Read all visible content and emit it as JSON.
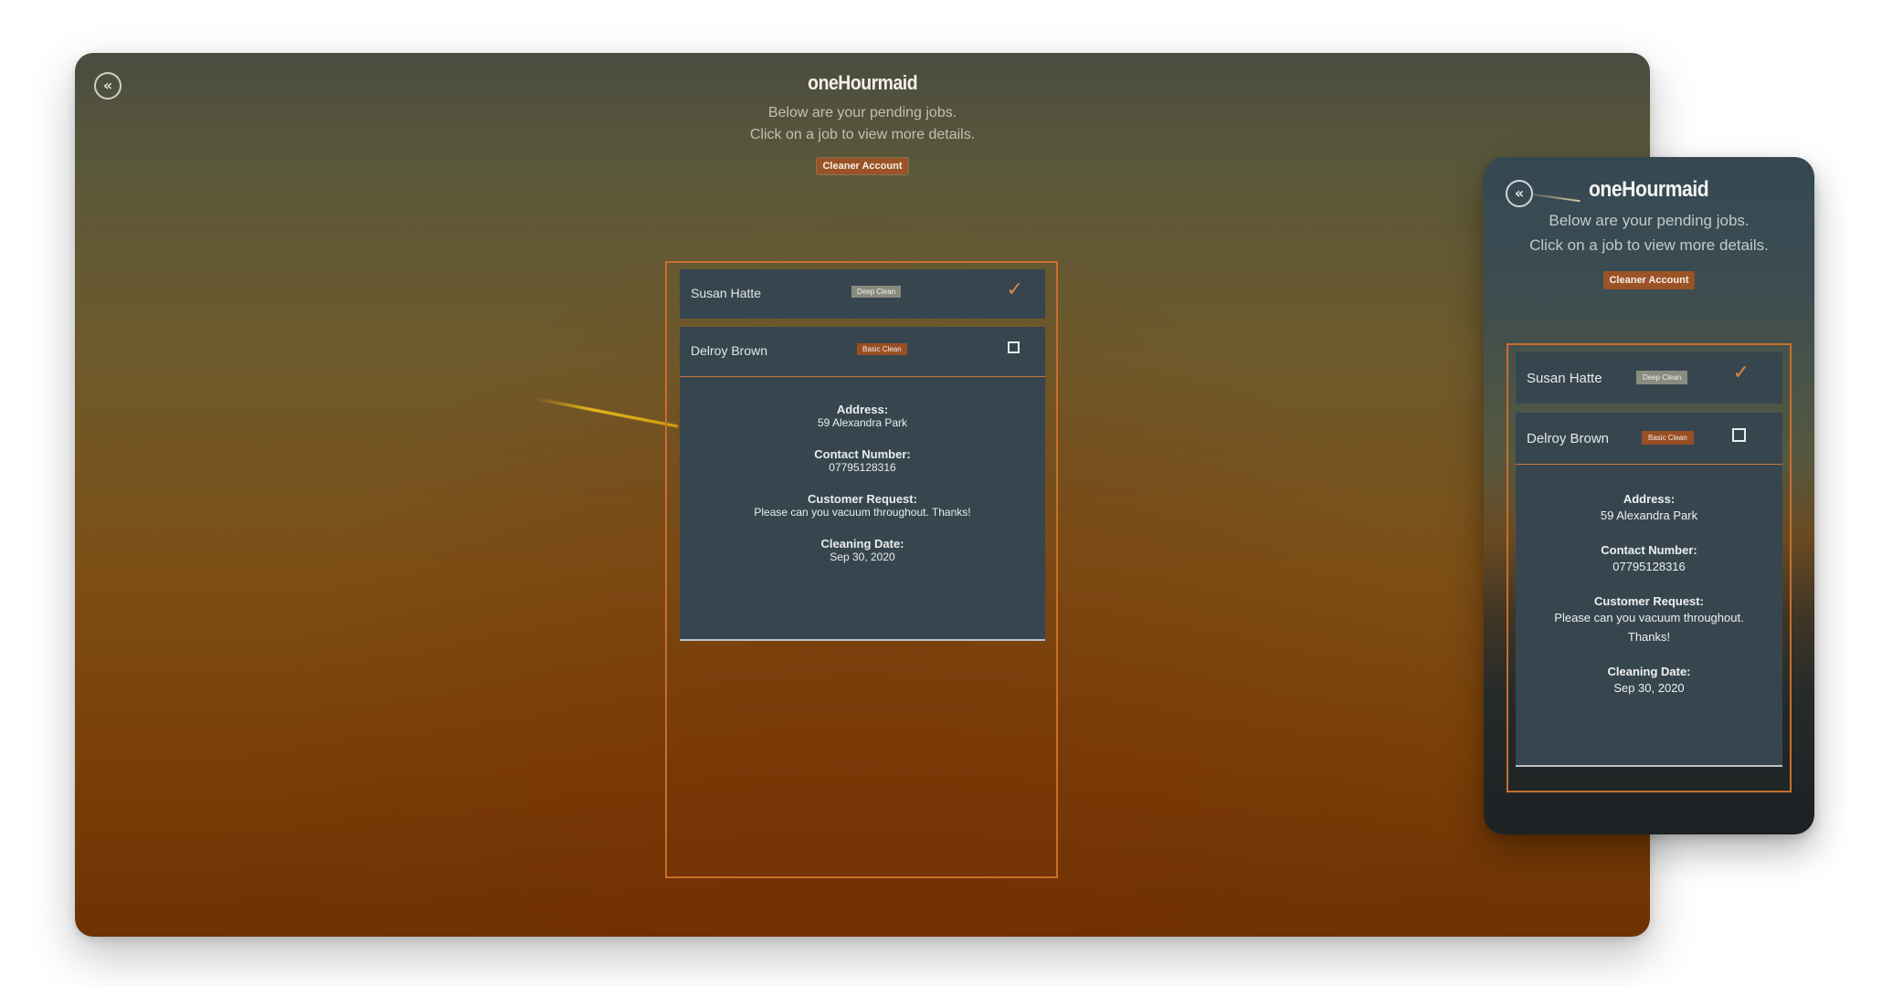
{
  "app": {
    "title": "oneHourmaid",
    "intro_line1": "Below are your pending jobs.",
    "intro_line2": "Click on a job to view more details.",
    "account_badge": "Cleaner Account",
    "back_icon": "double-chevron-left-icon"
  },
  "jobs": [
    {
      "name": "Susan Hatte",
      "type": "Deep Clean",
      "type_color": "#8a8b80",
      "status": "completed",
      "status_icon": "check-icon"
    },
    {
      "name": "Delroy Brown",
      "type": "Basic Clean",
      "type_color": "#9a4e24",
      "status": "pending",
      "status_icon": "checkbox-icon"
    }
  ],
  "details": {
    "address_label": "Address:",
    "address": "59 Alexandra Park",
    "contact_label": "Contact Number:",
    "contact": "07795128316",
    "request_label": "Customer Request:",
    "request": "Please can you vacuum throughout. Thanks!",
    "date_label": "Cleaning Date:",
    "date": "Sep 30, 2020"
  },
  "colors": {
    "accent": "#c76f2c",
    "badge": "#9a5326",
    "card": "#37464e"
  }
}
